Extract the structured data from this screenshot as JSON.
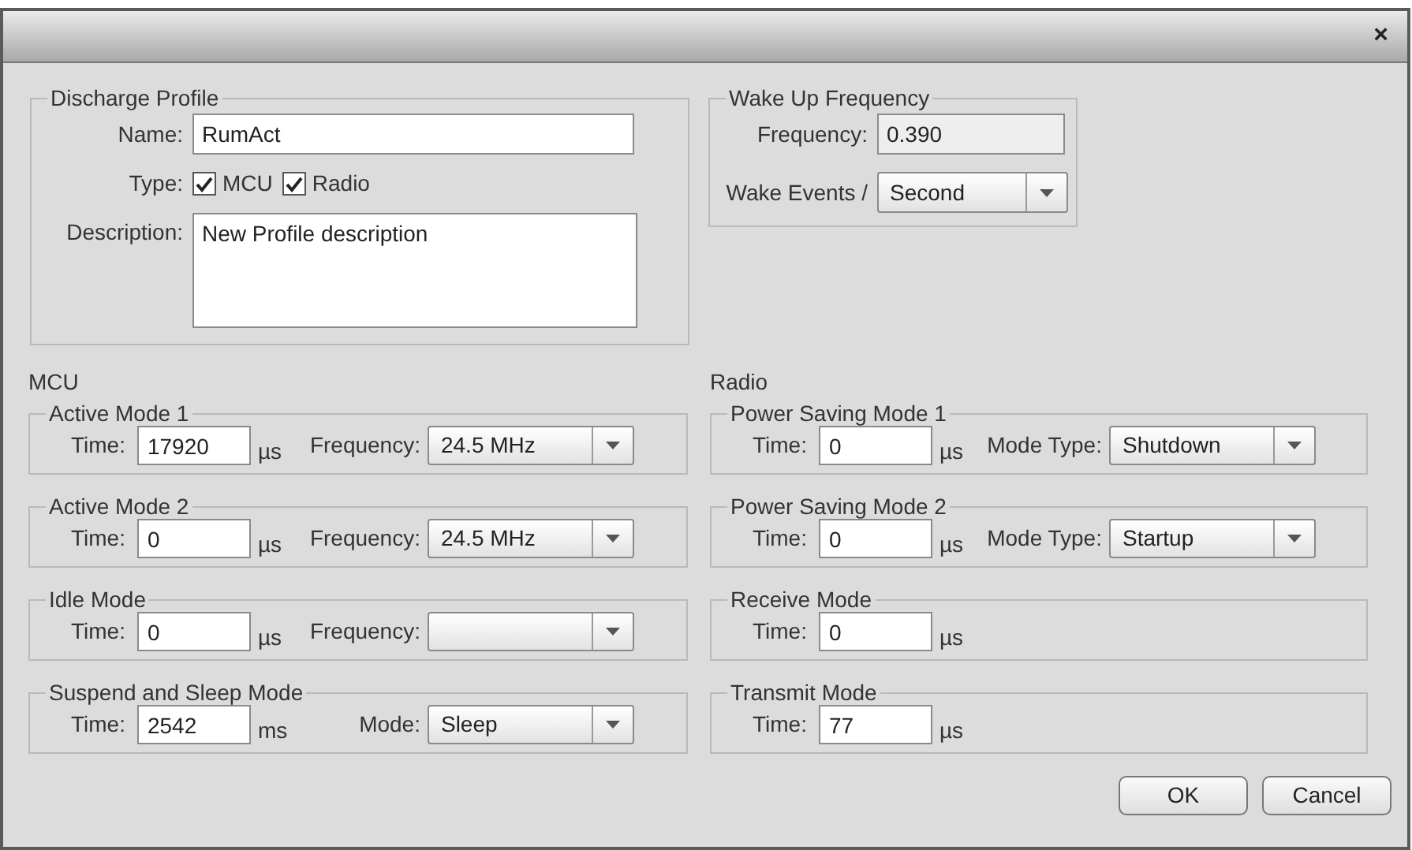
{
  "dialog": {
    "close": "×"
  },
  "discharge_profile": {
    "legend": "Discharge Profile",
    "name_label": "Name:",
    "name": "RumAct",
    "type_label": "Type:",
    "types": [
      {
        "label": "MCU",
        "checked": true
      },
      {
        "label": "Radio",
        "checked": true
      }
    ],
    "description_label": "Description:",
    "description": "New Profile description"
  },
  "wake_up": {
    "legend": "Wake Up Frequency",
    "frequency_label": "Frequency:",
    "frequency": {
      "value": "0.390",
      "disabled": true
    },
    "events_label": "Wake Events /",
    "events": "Second"
  },
  "mcu": {
    "heading": "MCU",
    "modes": [
      {
        "legend": "Active Mode 1",
        "time_label": "Time:",
        "time": "17920",
        "unit": "µs",
        "select_label": "Frequency:",
        "select": "24.5 MHz"
      },
      {
        "legend": "Active Mode 2",
        "time_label": "Time:",
        "time": "0",
        "unit": "µs",
        "select_label": "Frequency:",
        "select": "24.5 MHz"
      },
      {
        "legend": "Idle Mode",
        "time_label": "Time:",
        "time": "0",
        "unit": "µs",
        "select_label": "Frequency:"
      },
      {
        "legend": "Suspend and Sleep Mode",
        "time_label": "Time:",
        "time": "2542",
        "unit": "ms",
        "select_label": "Mode:",
        "select": "Sleep"
      }
    ]
  },
  "radio": {
    "heading": "Radio",
    "modes": [
      {
        "legend": "Power Saving Mode 1",
        "time_label": "Time:",
        "time": "0",
        "unit": "µs",
        "select_label": "Mode Type:",
        "select": "Shutdown"
      },
      {
        "legend": "Power Saving Mode 2",
        "time_label": "Time:",
        "time": "0",
        "unit": "µs",
        "select_label": "Mode Type:",
        "select": "Startup"
      },
      {
        "legend": "Receive Mode",
        "time_label": "Time:",
        "time": "0",
        "unit": "µs"
      },
      {
        "legend": "Transmit Mode",
        "time_label": "Time:",
        "time": "77",
        "unit": "µs"
      }
    ]
  },
  "buttons": [
    {
      "label": "OK"
    },
    {
      "label": "Cancel"
    }
  ]
}
